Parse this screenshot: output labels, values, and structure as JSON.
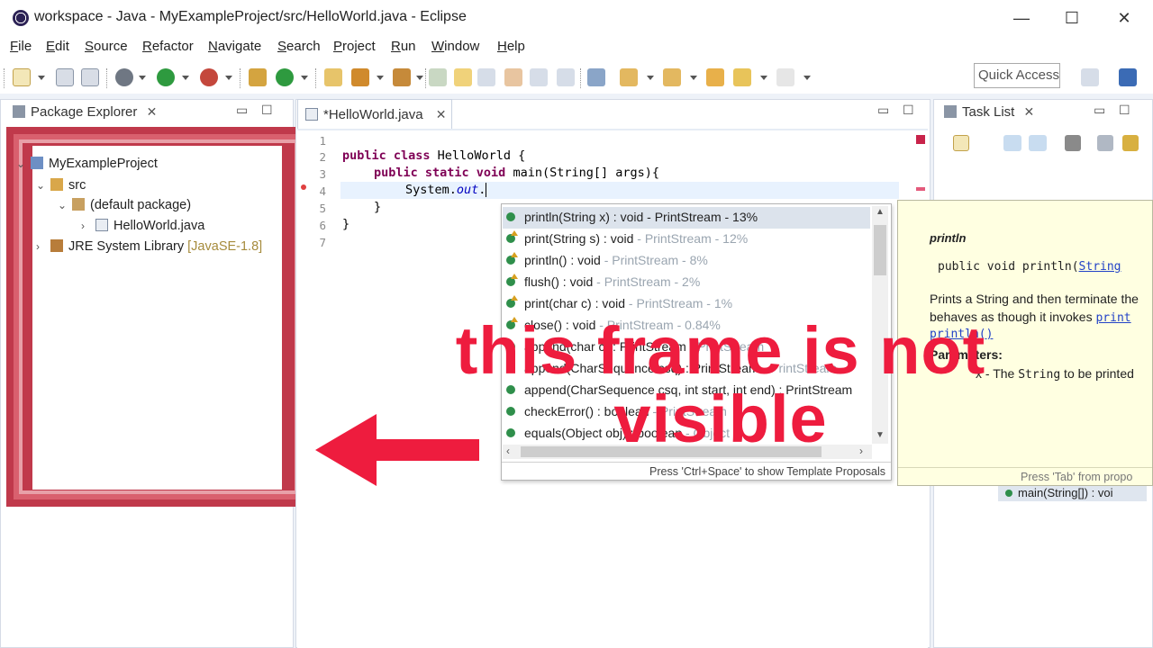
{
  "window": {
    "title": "workspace - Java - MyExampleProject/src/HelloWorld.java - Eclipse",
    "controls": [
      "—",
      "☐",
      "✕"
    ]
  },
  "menu": [
    "File",
    "Edit",
    "Source",
    "Refactor",
    "Navigate",
    "Search",
    "Project",
    "Run",
    "Window",
    "Help"
  ],
  "toolbar": {
    "quick_access": "Quick Access"
  },
  "package_explorer": {
    "tab_label": "Package Explorer",
    "tree": {
      "project": "MyExampleProject",
      "src": "src",
      "package": "(default package)",
      "file": "HelloWorld.java",
      "library": "JRE System Library",
      "library_decoration": "[JavaSE-1.8]"
    }
  },
  "editor": {
    "tab_label": "*HelloWorld.java",
    "line_numbers": [
      "1",
      "2",
      "3",
      "4",
      "5",
      "6",
      "7"
    ],
    "code": {
      "l2_kw": "public class",
      "l2_rest": " HelloWorld {",
      "l3_kw": "public static void",
      "l3_rest": " main(String[] args){",
      "l4_pre": "System.",
      "l4_field": "out",
      "l4_post": ".",
      "l5": "}",
      "l6": "}"
    }
  },
  "task_list": {
    "tab_label": "Task List",
    "outline_item": "main(String[]) : voi"
  },
  "content_assist": {
    "proposals": [
      {
        "main": "println(String x) : void - PrintStream - 13%",
        "qual": ""
      },
      {
        "main": "print(String s) : void",
        "qual": " - PrintStream - 12%"
      },
      {
        "main": "println() : void",
        "qual": " - PrintStream - 8%"
      },
      {
        "main": "flush() : void",
        "qual": " - PrintStream - 2%"
      },
      {
        "main": "print(char c) : void",
        "qual": " - PrintStream - 1%"
      },
      {
        "main": "close() : void",
        "qual": " - PrintStream - 0.84%"
      },
      {
        "main": "append(char c) : PrintStream",
        "qual": " - PrintStream"
      },
      {
        "main": "append(CharSequence csq) : PrintStream",
        "qual": " - PrintStream"
      },
      {
        "main": "append(CharSequence csq, int start, int end) : PrintStream",
        "qual": ""
      },
      {
        "main": "checkError() : boolean",
        "qual": " - PrintStream"
      },
      {
        "main": "equals(Object obj) : boolean",
        "qual": " - Object"
      }
    ],
    "footer": "Press 'Ctrl+Space' to show Template Proposals"
  },
  "javadoc": {
    "title": "println",
    "signature_pre": "public void println(",
    "signature_link": "String",
    "desc1": "Prints a String and then terminate the",
    "desc2_pre": "behaves as though it invokes ",
    "desc2_link": "print",
    "desc3_link": "println()",
    "params_heading": "Parameters:",
    "param_desc_pre": "x - The ",
    "param_desc_code": "String",
    "param_desc_post": " to be printed",
    "footer": "Press 'Tab' from propo"
  },
  "annotation": {
    "text_line1": "this frame is not",
    "text_line2": "visible",
    "color": "#ee1c3e",
    "frame_color": "#c0394b"
  }
}
